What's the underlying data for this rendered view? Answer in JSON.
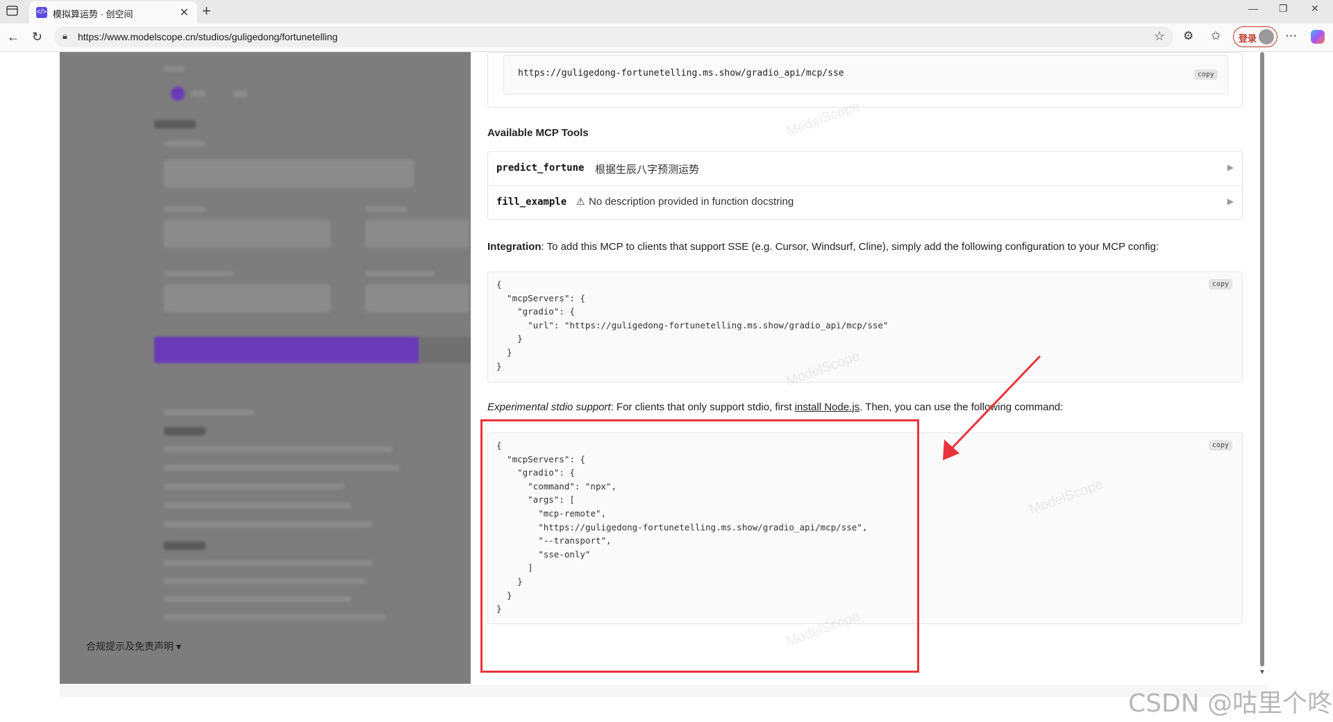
{
  "browser": {
    "tab_title": "模拟算运势 · 创空间",
    "tab_favicon": "</>",
    "url": "https://www.modelscope.cn/studios/guligedong/fortunetelling",
    "login_label": "登录"
  },
  "mcp": {
    "sse_url": "https://guligedong-fortunetelling.ms.show/gradio_api/mcp/sse",
    "copy_label": "copy",
    "tools_heading": "Available MCP Tools",
    "tools": [
      {
        "name": "predict_fortune",
        "description": "根据生辰八字预测运势",
        "warning": false
      },
      {
        "name": "fill_example",
        "description": "No description provided in function docstring",
        "warning": true
      }
    ],
    "integration_bold": "Integration",
    "integration_text": ": To add this MCP to clients that support SSE (e.g. Cursor, Windsurf, Cline), simply add the following configuration to your MCP config:",
    "sse_config": "{\n  \"mcpServers\": {\n    \"gradio\": {\n      \"url\": \"https://guligedong-fortunetelling.ms.show/gradio_api/mcp/sse\"\n    }\n  }\n}",
    "stdio_italic": "Experimental stdio support",
    "stdio_text_before": ": For clients that only support stdio, first ",
    "stdio_link": "install Node.js",
    "stdio_text_after": ". Then, you can use the following command:",
    "stdio_config": "{\n  \"mcpServers\": {\n    \"gradio\": {\n      \"command\": \"npx\",\n      \"args\": [\n        \"mcp-remote\",\n        \"https://guligedong-fortunetelling.ms.show/gradio_api/mcp/sse\",\n        \"--transport\",\n        \"sse-only\"\n      ]\n    }\n  }\n}"
  },
  "footer": {
    "disclaimer": "合规提示及免责声明 ▾"
  },
  "watermark": {
    "csdn": "CSDN @咕里个咚",
    "modelscope": "ModelScope"
  },
  "colors": {
    "annotation_red": "#e8333a",
    "primary_purple": "#6a3ab8"
  }
}
